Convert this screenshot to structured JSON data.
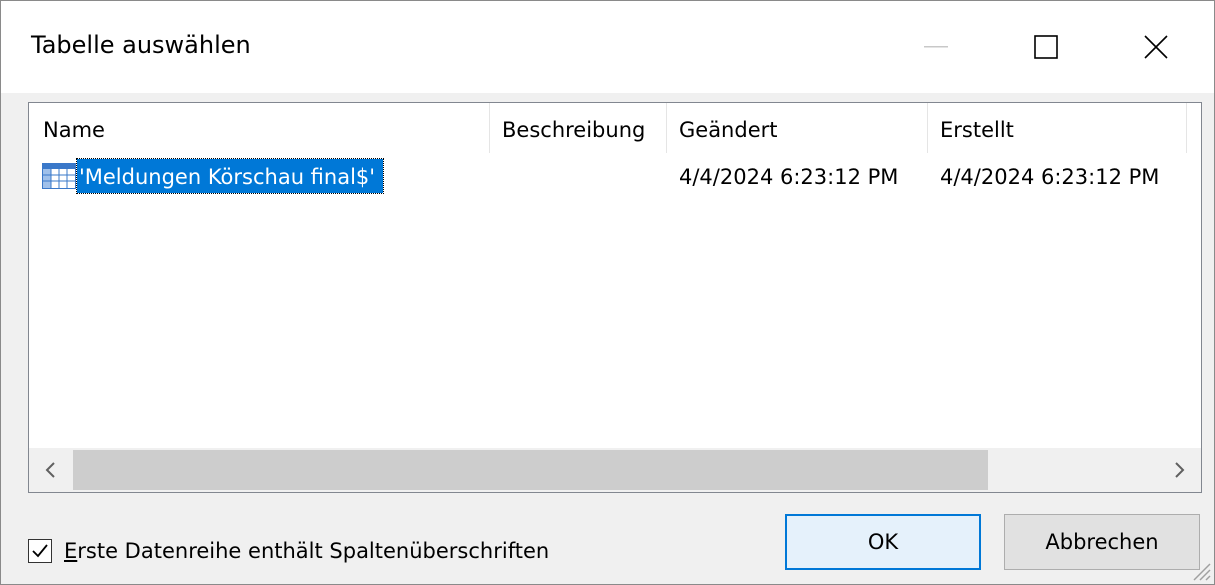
{
  "dialog": {
    "title": "Tabelle auswählen",
    "controls": {
      "minimize": "minimize-icon",
      "maximize": "maximize-icon",
      "close": "close-icon"
    }
  },
  "list": {
    "columns": [
      "Name",
      "Beschreibung",
      "Geändert",
      "Erstellt"
    ],
    "rows": [
      {
        "icon": "table-icon",
        "name": "'Meldungen Körschau final$'",
        "description": "",
        "modified": "4/4/2024 6:23:12 PM",
        "created": "4/4/2024 6:23:12 PM"
      }
    ]
  },
  "options": {
    "first_row_headers_checked": true,
    "first_row_headers_label_accel": "E",
    "first_row_headers_label_rest": "rste Datenreihe enthält Spaltenüberschriften"
  },
  "buttons": {
    "ok": "OK",
    "cancel": "Abbrechen"
  },
  "colors": {
    "selection": "#0078d7",
    "default_button_border": "#0078d7"
  }
}
